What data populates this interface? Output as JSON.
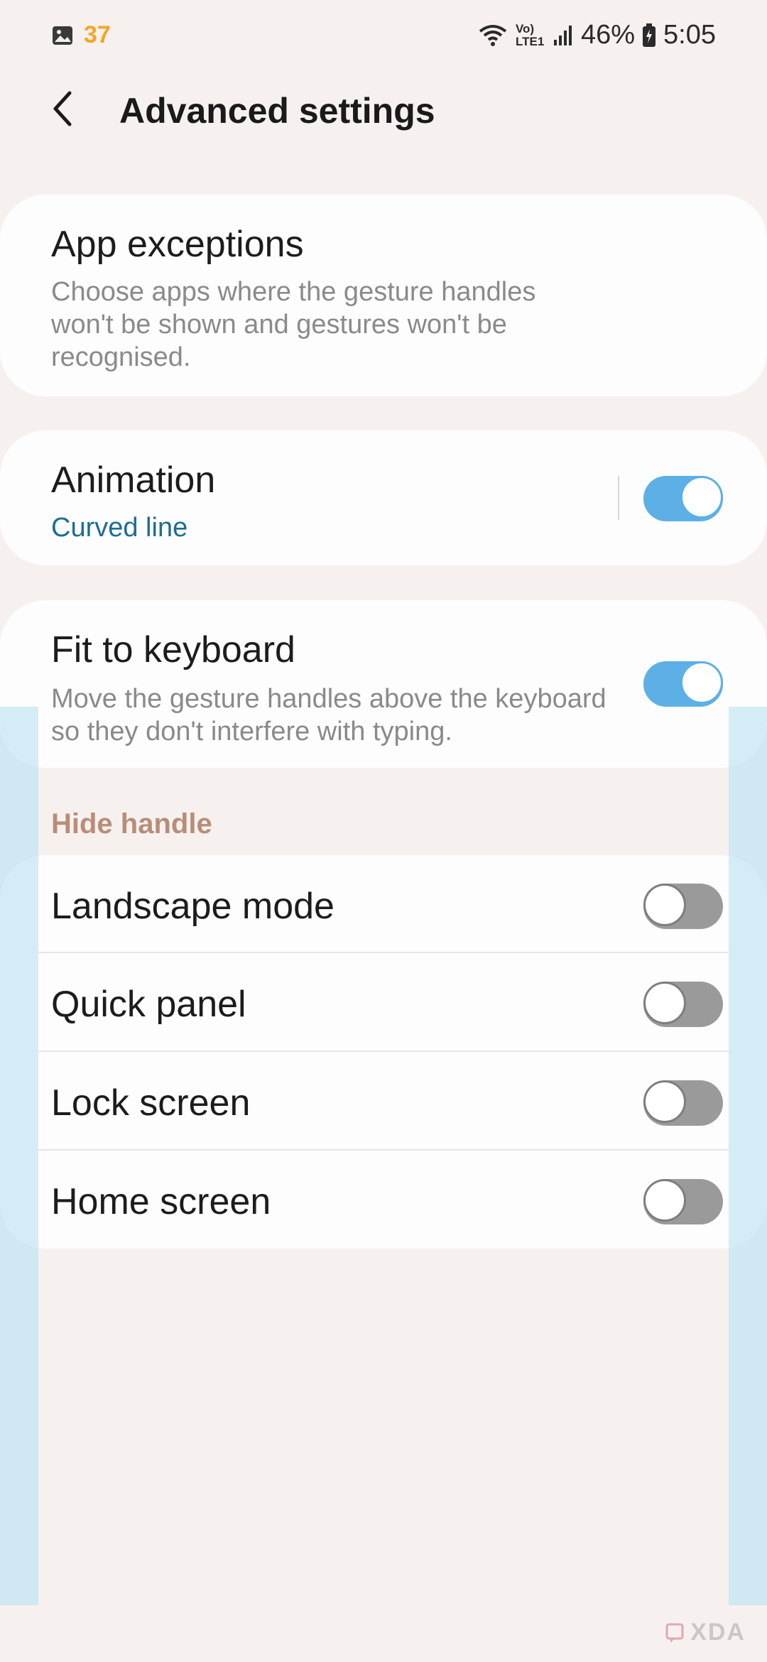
{
  "status_bar": {
    "notification_count": "37",
    "notification_icon": "gallery-icon",
    "network_label": "Vo) LTE1",
    "battery": "46%",
    "time": "5:05"
  },
  "header": {
    "title": "Advanced settings",
    "back_icon": "chevron-left-icon"
  },
  "settings": {
    "app_exceptions": {
      "title": "App exceptions",
      "description": "Choose apps where the gesture handles won't be shown and gestures won't be recognised."
    },
    "animation": {
      "title": "Animation",
      "value": "Curved line",
      "enabled": true
    },
    "fit_to_keyboard": {
      "title": "Fit to keyboard",
      "description": "Move the gesture handles above the keyboard so they don't interfere with typing.",
      "enabled": true
    }
  },
  "hide_handle": {
    "section_label": "Hide handle",
    "items": [
      {
        "label": "Landscape mode",
        "enabled": false
      },
      {
        "label": "Quick panel",
        "enabled": false
      },
      {
        "label": "Lock screen",
        "enabled": false
      },
      {
        "label": "Home screen",
        "enabled": false
      }
    ]
  },
  "watermark": "XDA",
  "colors": {
    "background": "#f6f1ef",
    "toggle_on": "#5cb0e6",
    "toggle_off": "#9a9a9a",
    "section_label": "#b88d78",
    "link_text": "#1f6c92",
    "notification_count": "#f5a524"
  }
}
